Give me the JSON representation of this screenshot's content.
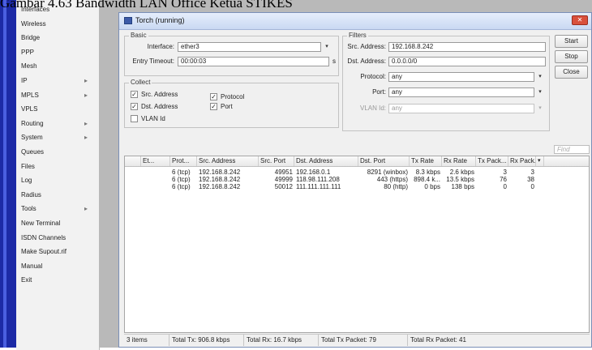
{
  "caption": "Gambar 4.63 Bandwidth LAN Office Ketua STIKES",
  "menu": [
    {
      "label": "Interfaces",
      "arrow": ""
    },
    {
      "label": "Wireless",
      "arrow": ""
    },
    {
      "label": "Bridge",
      "arrow": ""
    },
    {
      "label": "PPP",
      "arrow": ""
    },
    {
      "label": "Mesh",
      "arrow": ""
    },
    {
      "label": "IP",
      "arrow": "▸"
    },
    {
      "label": "MPLS",
      "arrow": "▸"
    },
    {
      "label": "VPLS",
      "arrow": ""
    },
    {
      "label": "Routing",
      "arrow": "▸"
    },
    {
      "label": "System",
      "arrow": "▸"
    },
    {
      "label": "Queues",
      "arrow": ""
    },
    {
      "label": "Files",
      "arrow": ""
    },
    {
      "label": "Log",
      "arrow": ""
    },
    {
      "label": "Radius",
      "arrow": ""
    },
    {
      "label": "Tools",
      "arrow": "▸"
    },
    {
      "label": "New Terminal",
      "arrow": ""
    },
    {
      "label": "ISDN Channels",
      "arrow": ""
    },
    {
      "label": "Make Supout.rif",
      "arrow": ""
    },
    {
      "label": "Manual",
      "arrow": ""
    },
    {
      "label": "Exit",
      "arrow": ""
    }
  ],
  "window": {
    "title": "Torch (running)",
    "close_label": "✕"
  },
  "basic": {
    "group_label": "Basic",
    "interface_label": "Interface:",
    "interface_value": "ether3",
    "entry_timeout_label": "Entry Timeout:",
    "entry_timeout_value": "00:00:03",
    "entry_timeout_unit": "s"
  },
  "collect": {
    "group_label": "Collect",
    "src_address": {
      "label": "Src. Address",
      "checked": true
    },
    "dst_address": {
      "label": "Dst. Address",
      "checked": true
    },
    "vlan_id": {
      "label": "VLAN Id",
      "checked": false
    },
    "protocol": {
      "label": "Protocol",
      "checked": true
    },
    "port": {
      "label": "Port",
      "checked": true
    }
  },
  "filters": {
    "group_label": "Filters",
    "src_address_label": "Src. Address:",
    "src_address_value": "192.168.8.242",
    "dst_address_label": "Dst. Address:",
    "dst_address_value": "0.0.0.0/0",
    "protocol_label": "Protocol:",
    "protocol_value": "any",
    "port_label": "Port:",
    "port_value": "any",
    "vlan_label": "VLAN Id:",
    "vlan_value": "any"
  },
  "buttons": {
    "start": "Start",
    "stop": "Stop",
    "close": "Close"
  },
  "find_placeholder": "Find",
  "table": {
    "columns": [
      "Et...",
      "Prot...",
      "Src. Address",
      "Src. Port",
      "Dst. Address",
      "Dst. Port",
      "Tx Rate",
      "Rx Rate",
      "Tx Pack...",
      "Rx Pack..."
    ],
    "rows": [
      [
        "",
        "6 (tcp)",
        "192.168.8.242",
        "49951",
        "192.168.0.1",
        "8291 (winbox)",
        "8.3 kbps",
        "2.6 kbps",
        "3",
        "3"
      ],
      [
        "",
        "6 (tcp)",
        "192.168.8.242",
        "49999",
        "118.98.111.208",
        "443 (https)",
        "898.4 k...",
        "13.5 kbps",
        "76",
        "38"
      ],
      [
        "",
        "6 (tcp)",
        "192.168.8.242",
        "50012",
        "111.111.111.111",
        "80 (http)",
        "0 bps",
        "138 bps",
        "0",
        "0"
      ]
    ]
  },
  "status": {
    "items": "3 items",
    "total_tx": "Total Tx: 906.8 kbps",
    "total_rx": "Total Rx: 16.7 kbps",
    "total_tx_packet": "Total Tx Packet: 79",
    "total_rx_packet": "Total Rx Packet: 41"
  },
  "colors": {
    "left_bar": "#1c2aa6",
    "workspace": "#b9b9b9",
    "titlebar": "#c9d8f2",
    "close_button": "#d9503c"
  }
}
